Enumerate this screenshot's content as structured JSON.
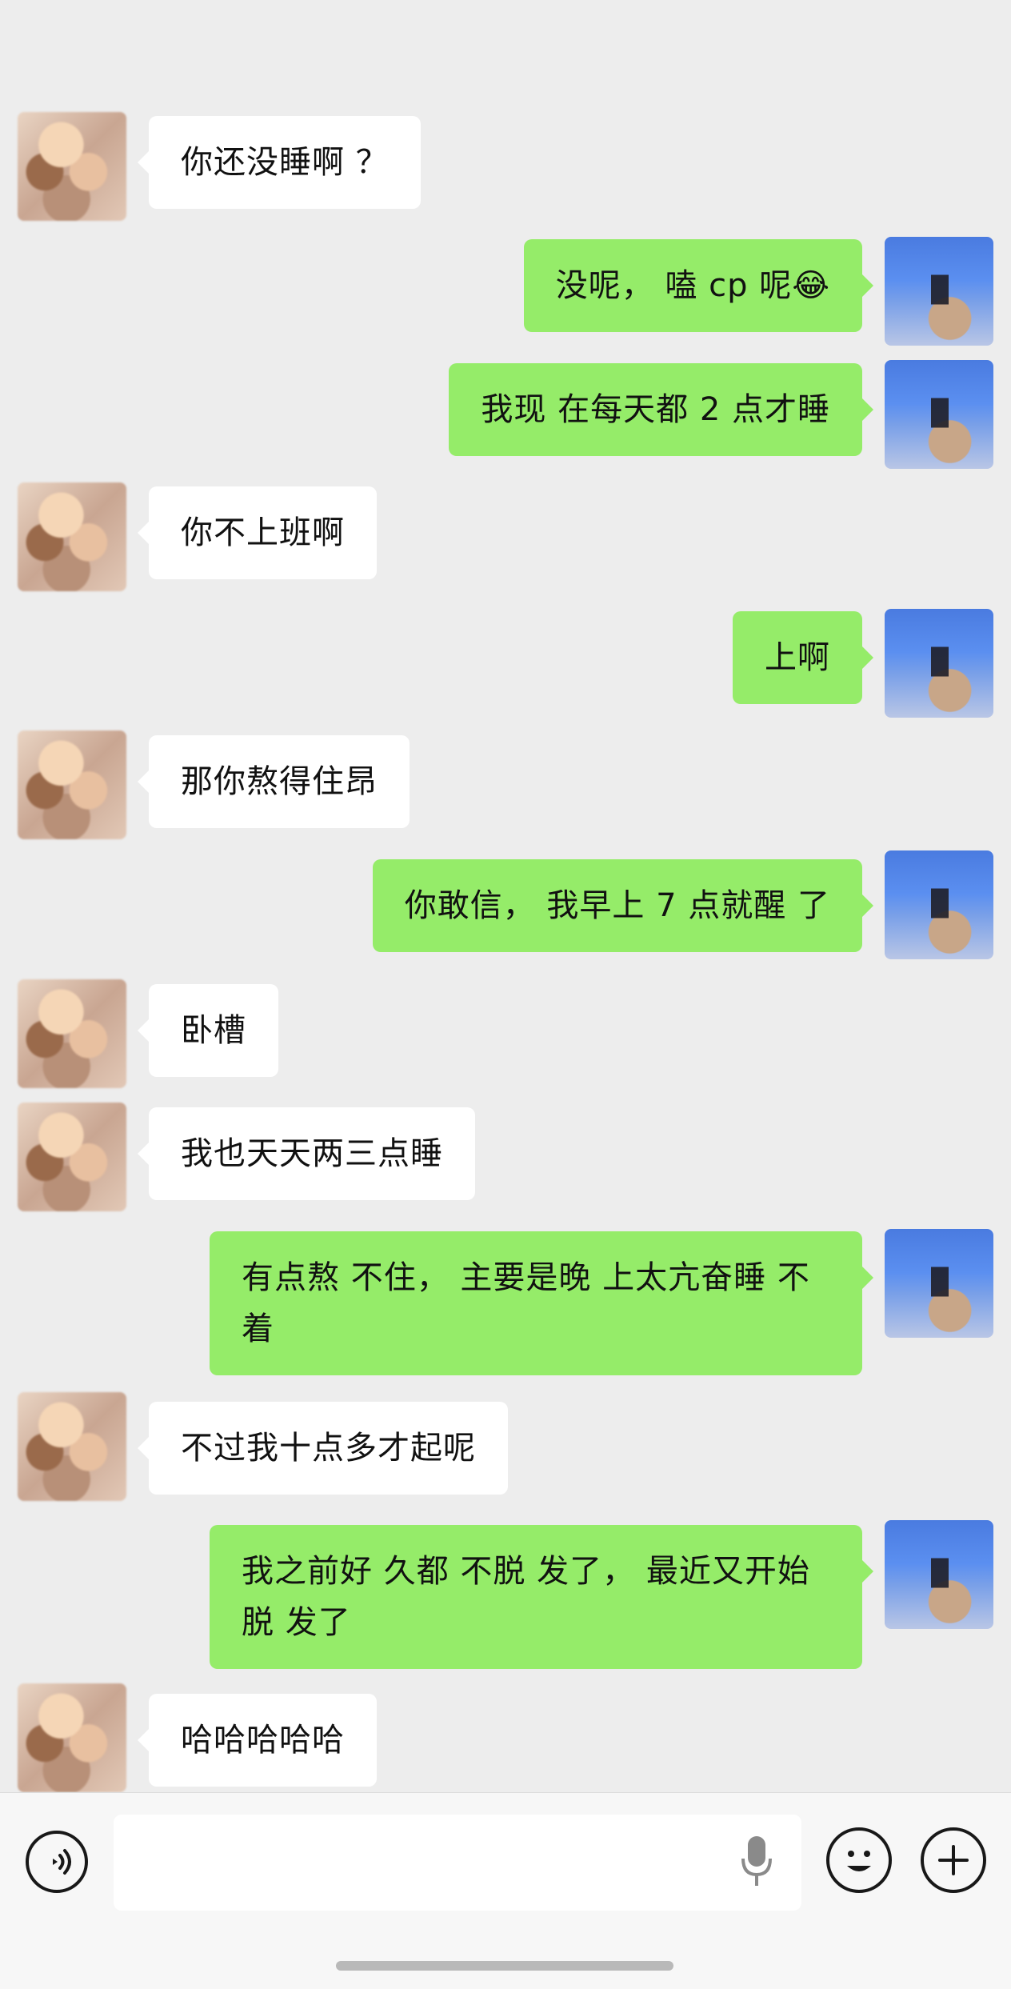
{
  "messages": [
    {
      "side": "left",
      "text": "你还没睡啊 ？"
    },
    {
      "side": "right",
      "text": "没呢， 嗑 cp 呢😂"
    },
    {
      "side": "right",
      "text": "我现 在每天都 2 点才睡"
    },
    {
      "side": "left",
      "text": "你不上班啊"
    },
    {
      "side": "right",
      "text": "上啊"
    },
    {
      "side": "left",
      "text": "那你熬得住昂"
    },
    {
      "side": "right",
      "text": "你敢信， 我早上 7 点就醒 了"
    },
    {
      "side": "left",
      "text": "卧槽"
    },
    {
      "side": "left",
      "text": "我也天天两三点睡"
    },
    {
      "side": "right",
      "text": "有点熬 不住， 主要是晚 上太亢奋睡 不\n着"
    },
    {
      "side": "left",
      "text": "不过我十点多才起呢"
    },
    {
      "side": "right",
      "text": "我之前好 久都 不脱 发了， 最近又开始\n脱 发了"
    },
    {
      "side": "left",
      "text": "哈哈哈哈哈"
    }
  ],
  "input_bar": {
    "placeholder": "",
    "value": "",
    "voice_icon": "voice-mode-icon",
    "mic_icon": "microphone-icon",
    "emoji_icon": "emoji-icon",
    "plus_icon": "plus-icon"
  },
  "colors": {
    "background": "#ededed",
    "incoming_bubble": "#ffffff",
    "outgoing_bubble": "#95ec69",
    "input_bar": "#f7f7f7"
  }
}
